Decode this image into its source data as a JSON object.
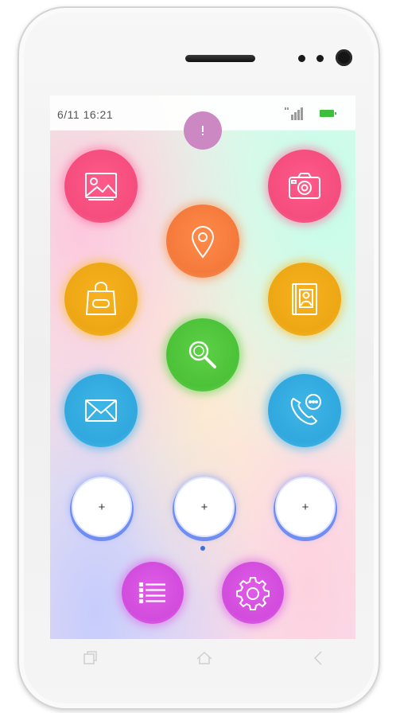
{
  "status_bar": {
    "time": "6/11 16:21",
    "signal_icon": "signal-icon",
    "battery_icon": "battery-icon",
    "battery_color": "#3dbf3d"
  },
  "pull_handle": {
    "icon": "pull-down-handle-icon",
    "color": "#cc88c2"
  },
  "apps": [
    {
      "name": "gallery",
      "icon": "image-icon",
      "color": "#f44d7e"
    },
    {
      "name": "camera",
      "icon": "camera-icon",
      "color": "#f44d7e"
    },
    {
      "name": "maps",
      "icon": "location-pin-icon",
      "color": "#f47a3c"
    },
    {
      "name": "shop",
      "icon": "shopping-bag-icon",
      "color": "#eea714"
    },
    {
      "name": "contacts",
      "icon": "contacts-book-icon",
      "color": "#eea714"
    },
    {
      "name": "search",
      "icon": "search-icon",
      "color": "#4cc238"
    },
    {
      "name": "messages",
      "icon": "mail-icon",
      "color": "#31a8de"
    },
    {
      "name": "phone",
      "icon": "phone-icon",
      "color": "#31a8de"
    }
  ],
  "add_slots": [
    "+",
    "+",
    "+"
  ],
  "dock": [
    {
      "name": "app-list",
      "icon": "list-icon",
      "color": "#d24cdd"
    },
    {
      "name": "settings",
      "icon": "gear-icon",
      "color": "#d24cdd"
    }
  ],
  "page_indicator": {
    "current": 1,
    "total": 1,
    "color": "#3c6fe0"
  },
  "nav_keys": [
    "recent-apps-icon",
    "home-icon",
    "back-icon"
  ]
}
